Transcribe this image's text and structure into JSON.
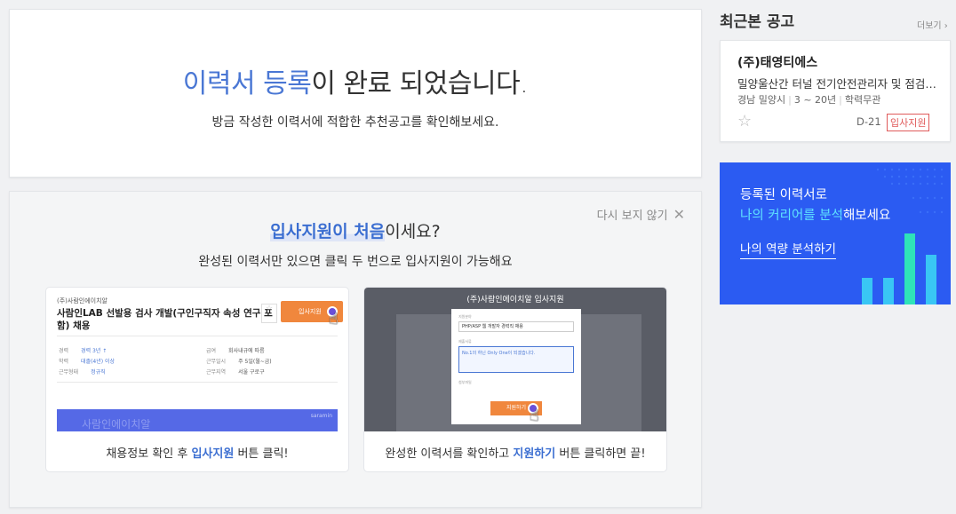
{
  "completion": {
    "title_highlight": "이력서 등록",
    "title_rest": "이 완료 되었습니다.",
    "subtitle": "방금 작성한 이력서에 적합한 추천공고를 확인해보세요."
  },
  "first_apply": {
    "dismiss_label": "다시 보지 않기",
    "headline_highlight": "입사지원이 처음",
    "headline_rest": "이세요?",
    "description": "완성된 이력서만 있으면 클릭 두 번으로 입사지원이 가능해요",
    "step1": {
      "company": "(주)사람인에이치알",
      "job_title": "사람인LAB 선발용 검사 개발(구인구직자 속성 연구 포함) 채용",
      "button": "입사지원",
      "banner_text": "사람인에이치알",
      "banner_brand": "saramin",
      "caption_pre": "채용정보 확인 후 ",
      "caption_highlight": "입사지원",
      "caption_post": " 버튼 클릭!"
    },
    "step2": {
      "header": "(주)사람인에이치알 입사지원",
      "select_value": "PHP/ASP 웹 개발자 경력직 채용",
      "box_text": "No.1의 하닌 Only One이 되겠습니다.",
      "button": "지원하기",
      "caption_pre": "완성한 이력서를 확인하고 ",
      "caption_highlight": "지원하기",
      "caption_post": " 버튼 클릭하면 끝!"
    }
  },
  "recent": {
    "title": "최근본 공고",
    "more_label": "더보기",
    "job": {
      "company": "(주)태영티에스",
      "title": "밀양울산간 터널 전기안전관리자 및 점검원 채용",
      "location": "경남 밀양시",
      "experience": "3 ~ 20년",
      "education": "학력무관",
      "dday": "D-21",
      "apply_label": "입사지원"
    }
  },
  "promo": {
    "line1": "등록된 이력서로",
    "line2_highlight": "나의 커리어를 분석",
    "line2_rest": "해보세요",
    "cta": "나의 역량 분석하기"
  }
}
